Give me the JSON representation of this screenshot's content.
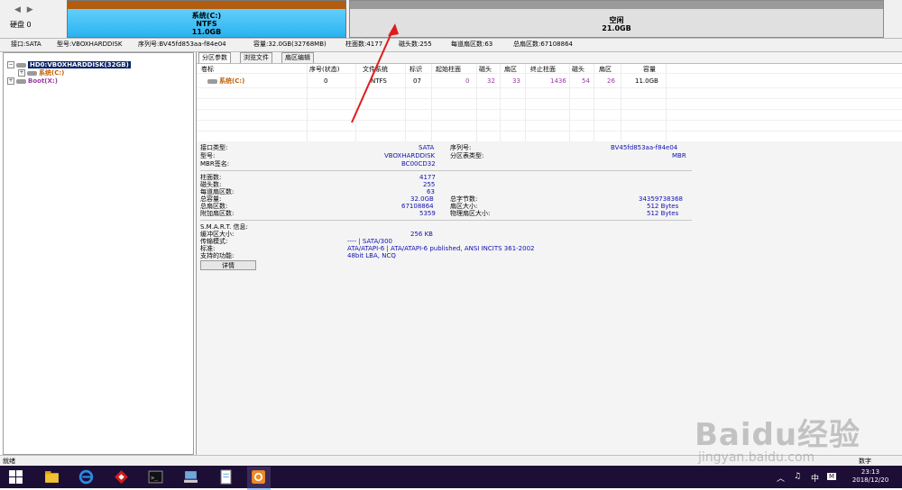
{
  "disk_map": {
    "nav": "◀ ▶",
    "disk_label": "硬盘 0",
    "partitions": [
      {
        "name": "系统(C:)",
        "fs": "NTFS",
        "size": "11.0GB",
        "color": "#29b3f0"
      },
      {
        "name": "空闲",
        "size": "21.0GB",
        "color": "#e0e0e0"
      }
    ]
  },
  "info_line": [
    "接口:SATA",
    "型号:VBOXHARDDISK",
    "序列号:BV45fd853aa-f84e04",
    "容量:32.0GB(32768MB)",
    "柱面数:4177",
    "磁头数:255",
    "每道扇区数:63",
    "总扇区数:67108864"
  ],
  "tree": {
    "root": "HD0:VBOXHARDDISK(32GB)",
    "children": [
      "系统(C:)",
      "Boot(X:)"
    ]
  },
  "tabs": [
    "分区参数",
    "浏览文件",
    "扇区编辑"
  ],
  "table": {
    "headers": [
      "卷标",
      "序号(状态)",
      "文件系统",
      "标识",
      "起始柱面",
      "磁头",
      "扇区",
      "终止柱面",
      "磁头",
      "扇区",
      "容量"
    ],
    "rows": [
      [
        "系统(C:)",
        "0",
        "NTFS",
        "07",
        "0",
        "32",
        "33",
        "1436",
        "54",
        "26",
        "11.0GB"
      ]
    ]
  },
  "details": {
    "interface_label": "接口类型:",
    "interface_value": "SATA",
    "serial_label": "序列号:",
    "serial_value": "BV45fd853aa-f84e04",
    "model_label": "型号:",
    "model_value": "VBOXHARDDISK",
    "ptype_label": "分区表类型:",
    "ptype_value": "MBR",
    "mbr_label": "MBR签名:",
    "mbr_value": "BC00CD32",
    "cyl_label": "柱面数:",
    "cyl_value": "4177",
    "heads_label": "磁头数:",
    "heads_value": "255",
    "spt_label": "每道扇区数:",
    "spt_value": "63",
    "cap_label": "总容量:",
    "cap_value": "32.0GB",
    "bytes_label": "总字节数:",
    "bytes_value": "34359738368",
    "sectors_label": "总扇区数:",
    "sectors_value": "67108864",
    "secsize_label": "扇区大小:",
    "secsize_value": "512 Bytes",
    "extra_label": "附加扇区数:",
    "extra_value": "5359",
    "phys_label": "物理扇区大小:",
    "phys_value": "512 Bytes",
    "smart_label": "S.M.A.R.T. 信息:",
    "buffer_label": "缓冲区大小:",
    "buffer_value": "256 KB",
    "mode_label": "传输模式:",
    "mode_value": "---- | SATA/300",
    "std_label": "标准:",
    "std_value": "ATA/ATAPI-6 | ATA/ATAPI-6 published, ANSI INCITS 361-2002",
    "feat_label": "支持的功能:",
    "feat_value": "48bit LBA, NCQ",
    "button": "详情"
  },
  "status": {
    "left": "就绪",
    "right": "数字"
  },
  "taskbar": {
    "time": "23:13",
    "date": "2018/12/20",
    "ime": "中",
    "ime_mode": "M"
  },
  "watermark": {
    "brand": "Baidu经验",
    "url": "jingyan.baidu.com"
  }
}
